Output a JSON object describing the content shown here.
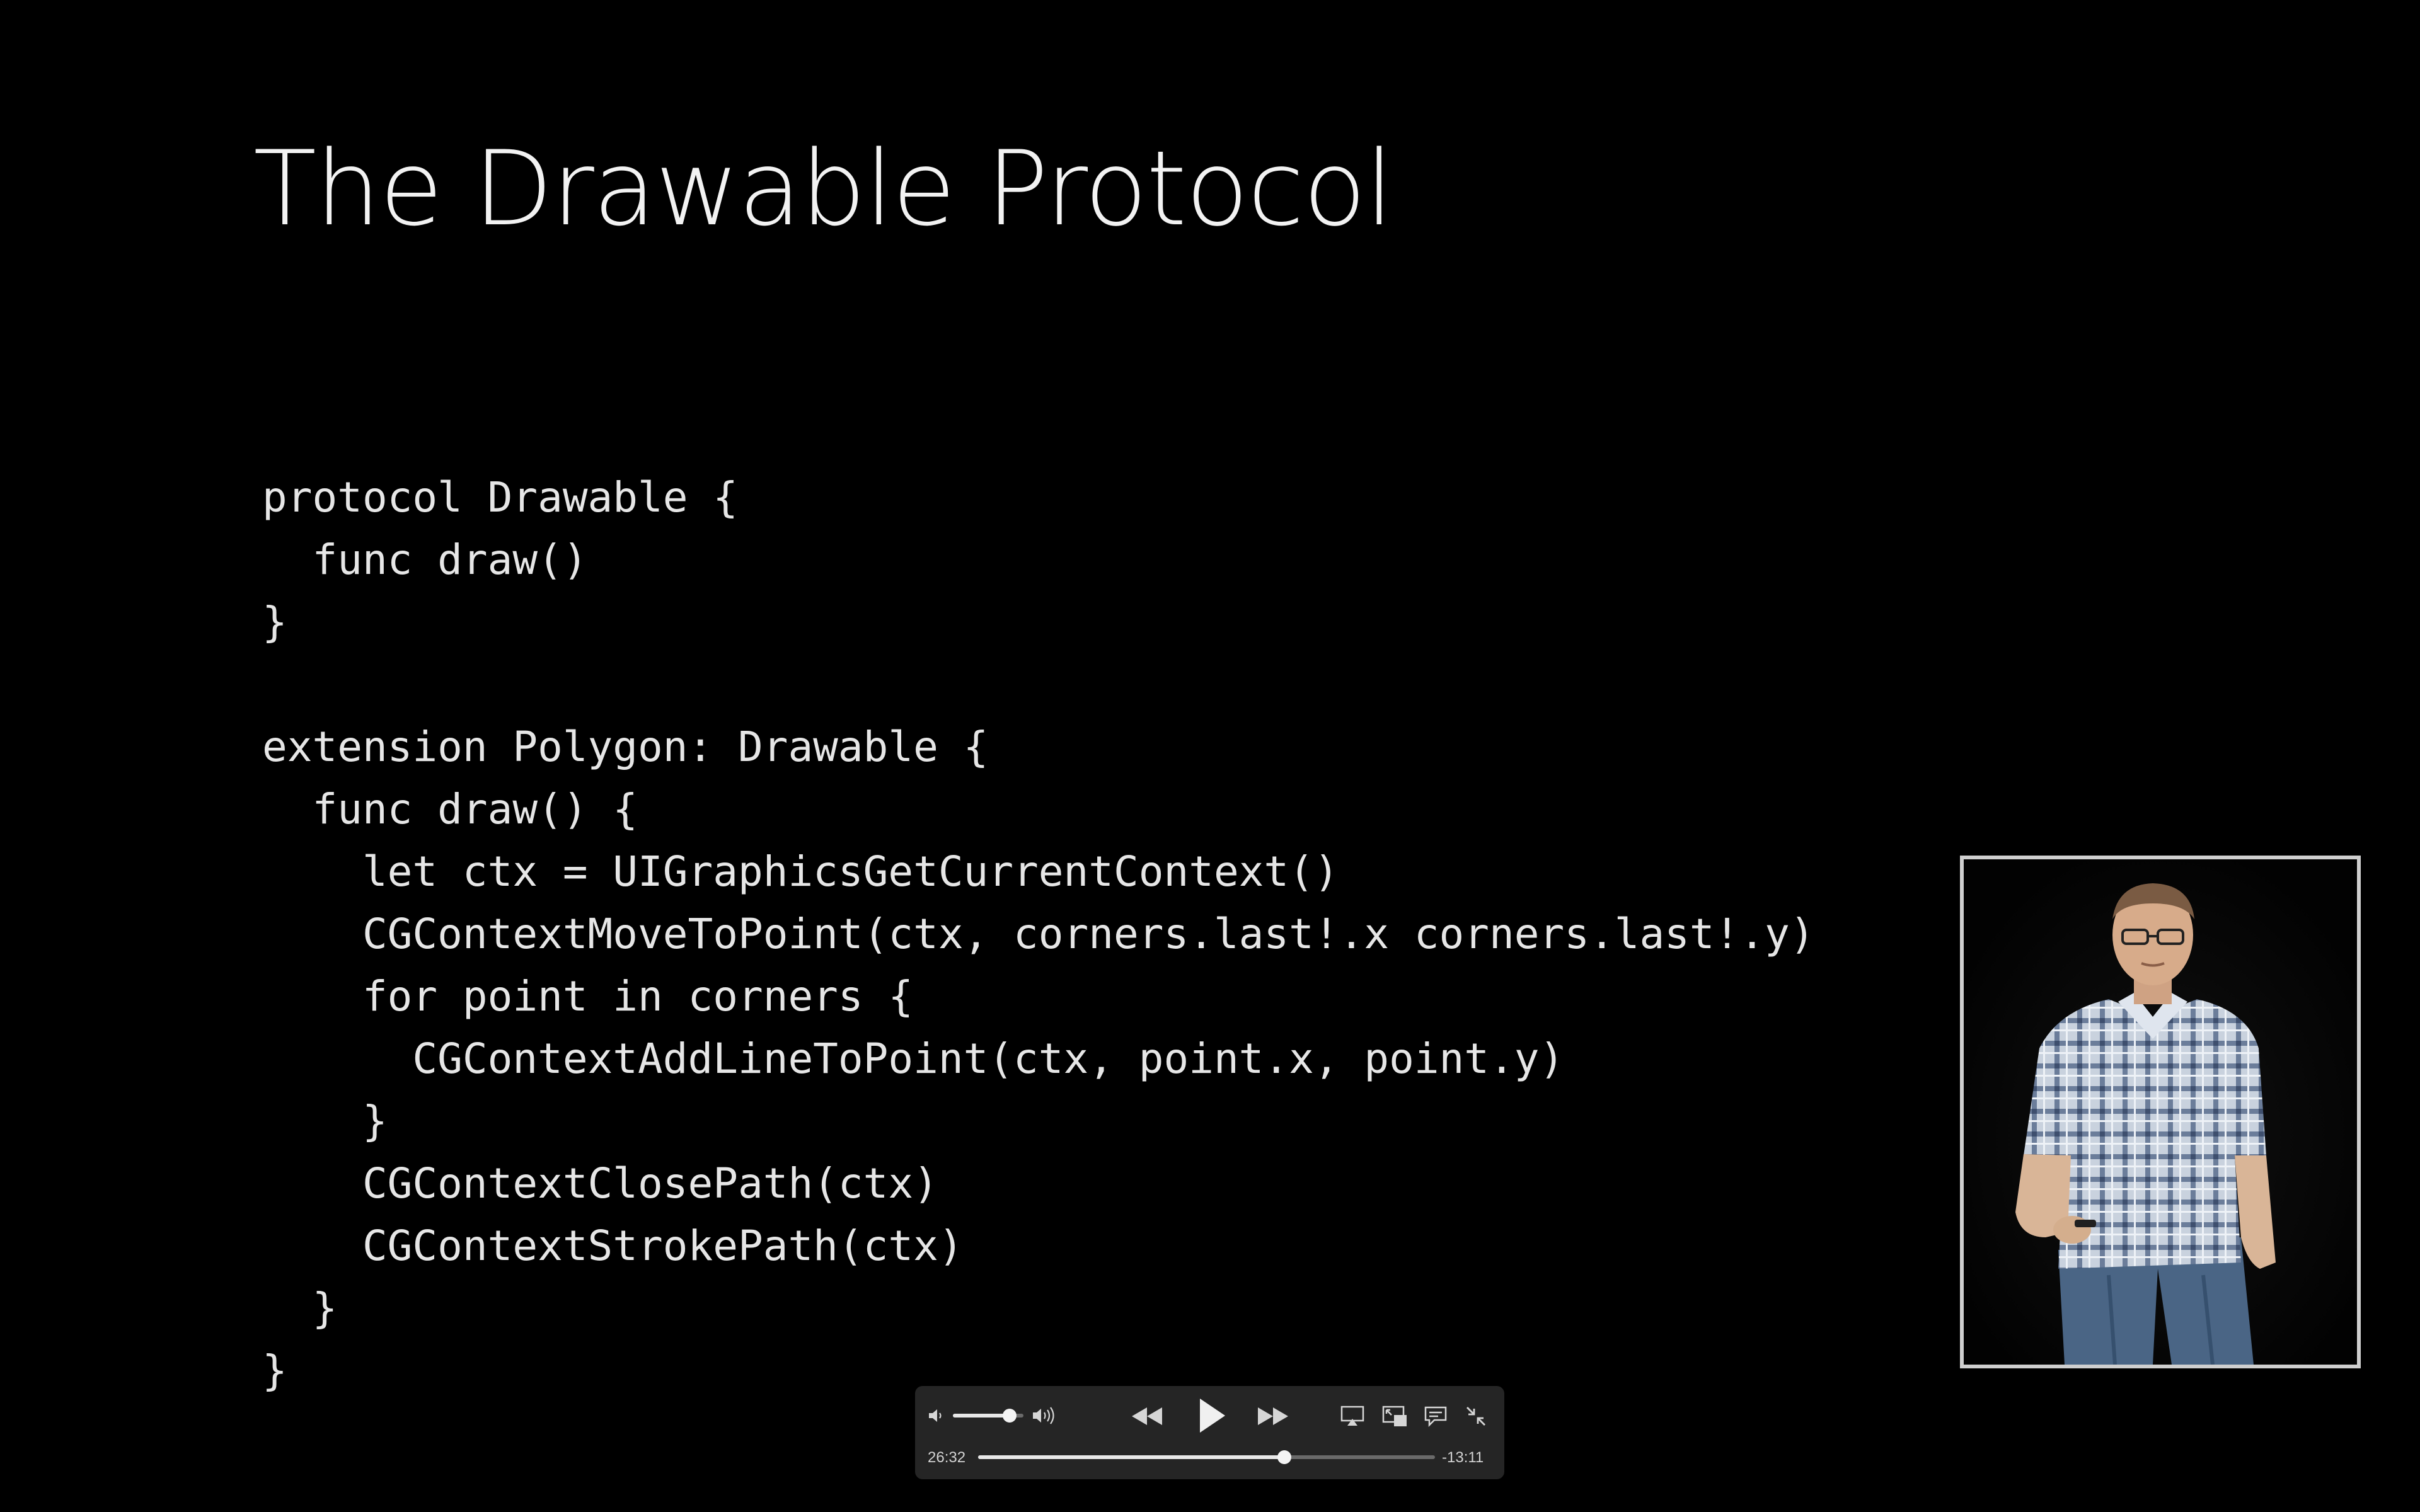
{
  "slide": {
    "title": "The Drawable Protocol",
    "code_lines": [
      "protocol Drawable {",
      "  func draw()",
      "}",
      "",
      "extension Polygon: Drawable {",
      "  func draw() {",
      "    let ctx = UIGraphicsGetCurrentContext()",
      "    CGContextMoveToPoint(ctx, corners.last!.x corners.last!.y)",
      "    for point in corners {",
      "      CGContextAddLineToPoint(ctx, point.x, point.y)",
      "    }",
      "    CGContextClosePath(ctx)",
      "    CGContextStrokePath(ctx)",
      "  }",
      "}"
    ]
  },
  "player": {
    "elapsed": "26:32",
    "remaining": "-13:11",
    "progress_fraction": 0.67,
    "volume_fraction": 0.8,
    "icons": {
      "volume_low": "speaker-low-icon",
      "volume_high": "speaker-high-icon",
      "rewind": "rewind-icon",
      "play": "play-icon",
      "fast_forward": "fast-forward-icon",
      "airplay": "airplay-icon",
      "picture_in_picture": "picture-in-picture-icon",
      "subtitles": "subtitles-icon",
      "exit_fullscreen": "exit-fullscreen-icon"
    }
  },
  "colors": {
    "background": "#000000",
    "text": "#e6e6e6",
    "controls_bg": "#262626"
  }
}
